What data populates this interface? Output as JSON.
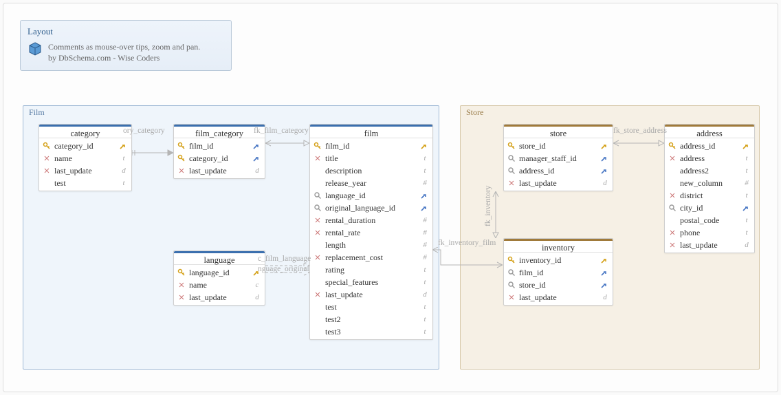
{
  "info": {
    "title": "Layout",
    "line1": "Comments as mouse-over tips, zoom and pan.",
    "line2": "by DbSchema.com - Wise Coders"
  },
  "groups": {
    "film": "Film",
    "store": "Store"
  },
  "tables": {
    "category": {
      "title": "category",
      "cols": [
        {
          "n": "category_id",
          "i": "pk",
          "t": "pk"
        },
        {
          "n": "name",
          "i": "nn",
          "t": "t"
        },
        {
          "n": "last_update",
          "i": "nn",
          "t": "d"
        },
        {
          "n": "test",
          "i": "",
          "t": "t"
        }
      ]
    },
    "film_category": {
      "title": "film_category",
      "cols": [
        {
          "n": "film_id",
          "i": "pk",
          "t": "fk"
        },
        {
          "n": "category_id",
          "i": "pk",
          "t": "fk"
        },
        {
          "n": "last_update",
          "i": "nn",
          "t": "d"
        }
      ]
    },
    "film": {
      "title": "film",
      "cols": [
        {
          "n": "film_id",
          "i": "pk",
          "t": "pk"
        },
        {
          "n": "title",
          "i": "nn",
          "t": "t"
        },
        {
          "n": "description",
          "i": "",
          "t": "t"
        },
        {
          "n": "release_year",
          "i": "",
          "t": "#"
        },
        {
          "n": "language_id",
          "i": "idx",
          "t": "fk"
        },
        {
          "n": "original_language_id",
          "i": "idx",
          "t": "fk"
        },
        {
          "n": "rental_duration",
          "i": "nn",
          "t": "#"
        },
        {
          "n": "rental_rate",
          "i": "nn",
          "t": "#"
        },
        {
          "n": "length",
          "i": "",
          "t": "#"
        },
        {
          "n": "replacement_cost",
          "i": "nn",
          "t": "#"
        },
        {
          "n": "rating",
          "i": "",
          "t": "t"
        },
        {
          "n": "special_features",
          "i": "",
          "t": "t"
        },
        {
          "n": "last_update",
          "i": "nn",
          "t": "d"
        },
        {
          "n": "test",
          "i": "",
          "t": "t"
        },
        {
          "n": "test2",
          "i": "",
          "t": "t"
        },
        {
          "n": "test3",
          "i": "",
          "t": "t"
        }
      ]
    },
    "language": {
      "title": "language",
      "cols": [
        {
          "n": "language_id",
          "i": "pk",
          "t": "pk"
        },
        {
          "n": "name",
          "i": "nn",
          "t": "c"
        },
        {
          "n": "last_update",
          "i": "nn",
          "t": "d"
        }
      ]
    },
    "store": {
      "title": "store",
      "cols": [
        {
          "n": "store_id",
          "i": "pk",
          "t": "pk"
        },
        {
          "n": "manager_staff_id",
          "i": "idx",
          "t": "fk"
        },
        {
          "n": "address_id",
          "i": "idx",
          "t": "fk"
        },
        {
          "n": "last_update",
          "i": "nn",
          "t": "d"
        }
      ]
    },
    "inventory": {
      "title": "inventory",
      "cols": [
        {
          "n": "inventory_id",
          "i": "pk",
          "t": "pk"
        },
        {
          "n": "film_id",
          "i": "idx",
          "t": "fk"
        },
        {
          "n": "store_id",
          "i": "idx",
          "t": "fk"
        },
        {
          "n": "last_update",
          "i": "nn",
          "t": "d"
        }
      ]
    },
    "address": {
      "title": "address",
      "cols": [
        {
          "n": "address_id",
          "i": "pk",
          "t": "pk"
        },
        {
          "n": "address",
          "i": "nn",
          "t": "t"
        },
        {
          "n": "address2",
          "i": "",
          "t": "t"
        },
        {
          "n": "new_column",
          "i": "",
          "t": "#"
        },
        {
          "n": "district",
          "i": "nn",
          "t": "t"
        },
        {
          "n": "city_id",
          "i": "idx",
          "t": "fk"
        },
        {
          "n": "postal_code",
          "i": "",
          "t": "t"
        },
        {
          "n": "phone",
          "i": "nn",
          "t": "t"
        },
        {
          "n": "last_update",
          "i": "nn",
          "t": "d"
        }
      ]
    }
  },
  "fks": {
    "a": "ory_category",
    "b": "fk_film_category",
    "c": "c_film_language",
    "d": "nguage_original",
    "e": "fk_inventory_film",
    "f": "fk_inventory",
    "g": "fk_store_address"
  }
}
